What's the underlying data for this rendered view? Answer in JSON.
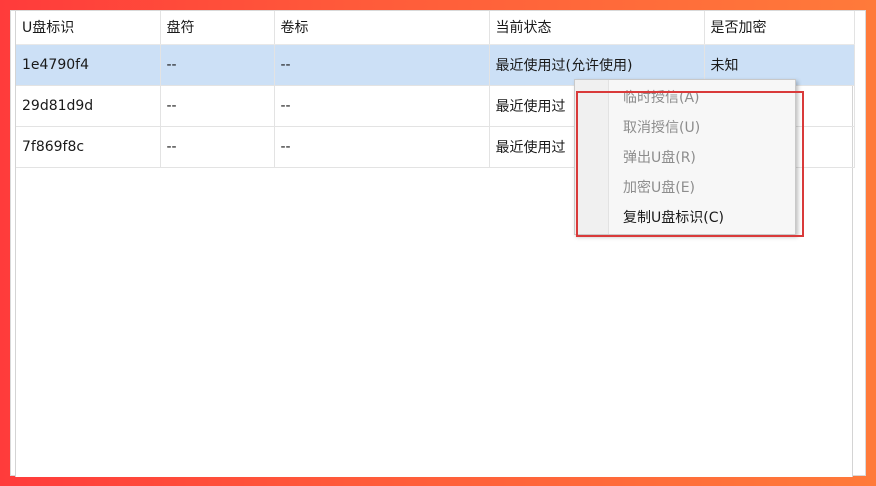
{
  "colors": {
    "frame_accent": "#ff3b3b",
    "selected_row": "#cce0f6",
    "highlight": "#d93a3a"
  },
  "table": {
    "headers": [
      "U盘标识",
      "盘符",
      "卷标",
      "当前状态",
      "是否加密"
    ],
    "rows": [
      [
        "1e4790f4",
        "--",
        "--",
        "最近使用过(允许使用)",
        "未知"
      ],
      [
        "29d81d9d",
        "--",
        "--",
        "最近使用过",
        ""
      ],
      [
        "7f869f8c",
        "--",
        "--",
        "最近使用过",
        ""
      ]
    ],
    "selected_row": 0
  },
  "context_menu": {
    "items": [
      {
        "label": "临时授信(A)",
        "enabled": false
      },
      {
        "label": "取消授信(U)",
        "enabled": false
      },
      {
        "label": "弹出U盘(R)",
        "enabled": false
      },
      {
        "label": "加密U盘(E)",
        "enabled": false
      },
      {
        "label": "复制U盘标识(C)",
        "enabled": true
      }
    ]
  }
}
